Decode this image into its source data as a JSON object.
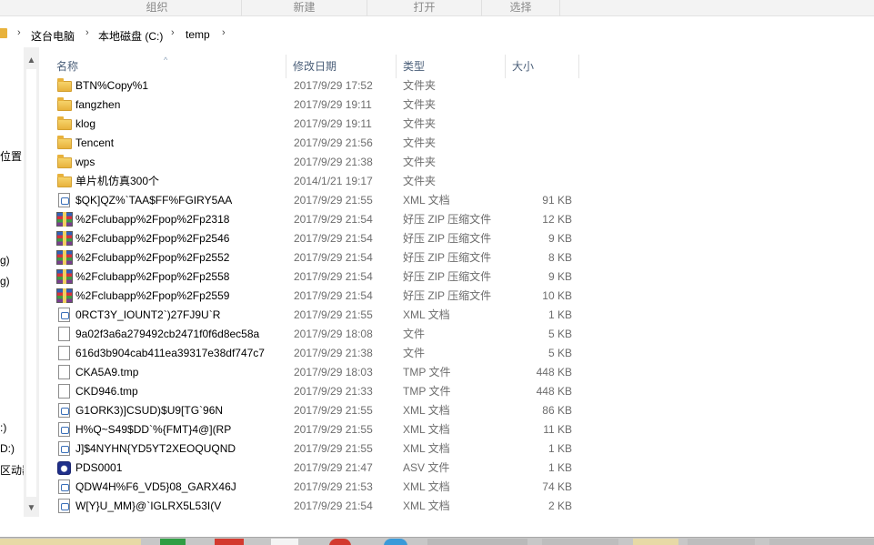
{
  "ribbon": {
    "groups": [
      "组织",
      "新建",
      "打开",
      "选择"
    ]
  },
  "address": {
    "crumbs": [
      "这台电脑",
      "本地磁盘 (C:)",
      "temp"
    ],
    "separator": "›"
  },
  "nav_pane": {
    "fragments": [
      "位置",
      "g)",
      "g)",
      ":)",
      "D:)",
      "区动器"
    ],
    "scroll_up": "▲",
    "scroll_down": "▼"
  },
  "columns": {
    "name": "名称",
    "date": "修改日期",
    "type": "类型",
    "size": "大小",
    "sort_indicator": "^"
  },
  "files": [
    {
      "name": "BTN%Copy%1",
      "date": "2017/9/29 17:52",
      "type": "文件夹",
      "size": "",
      "icon": "folder"
    },
    {
      "name": "fangzhen",
      "date": "2017/9/29 19:11",
      "type": "文件夹",
      "size": "",
      "icon": "folder"
    },
    {
      "name": "klog",
      "date": "2017/9/29 19:11",
      "type": "文件夹",
      "size": "",
      "icon": "folder"
    },
    {
      "name": "Tencent",
      "date": "2017/9/29 21:56",
      "type": "文件夹",
      "size": "",
      "icon": "folder"
    },
    {
      "name": "wps",
      "date": "2017/9/29 21:38",
      "type": "文件夹",
      "size": "",
      "icon": "folder"
    },
    {
      "name": "单片机仿真300个",
      "date": "2014/1/21 19:17",
      "type": "文件夹",
      "size": "",
      "icon": "folder"
    },
    {
      "name": "$QK]QZ%`TAA$FF%FGIRY5AA",
      "date": "2017/9/29 21:55",
      "type": "XML 文档",
      "size": "91 KB",
      "icon": "xml"
    },
    {
      "name": "%2Fclubapp%2Fpop%2Fp2318",
      "date": "2017/9/29 21:54",
      "type": "好压 ZIP 压缩文件",
      "size": "12 KB",
      "icon": "zip"
    },
    {
      "name": "%2Fclubapp%2Fpop%2Fp2546",
      "date": "2017/9/29 21:54",
      "type": "好压 ZIP 压缩文件",
      "size": "9 KB",
      "icon": "zip"
    },
    {
      "name": "%2Fclubapp%2Fpop%2Fp2552",
      "date": "2017/9/29 21:54",
      "type": "好压 ZIP 压缩文件",
      "size": "8 KB",
      "icon": "zip"
    },
    {
      "name": "%2Fclubapp%2Fpop%2Fp2558",
      "date": "2017/9/29 21:54",
      "type": "好压 ZIP 压缩文件",
      "size": "9 KB",
      "icon": "zip"
    },
    {
      "name": "%2Fclubapp%2Fpop%2Fp2559",
      "date": "2017/9/29 21:54",
      "type": "好压 ZIP 压缩文件",
      "size": "10 KB",
      "icon": "zip"
    },
    {
      "name": "0RCT3Y_IOUNT2`)27FJ9U`R",
      "date": "2017/9/29 21:55",
      "type": "XML 文档",
      "size": "1 KB",
      "icon": "xml"
    },
    {
      "name": "9a02f3a6a279492cb2471f0f6d8ec58a",
      "date": "2017/9/29 18:08",
      "type": "文件",
      "size": "5 KB",
      "icon": "file"
    },
    {
      "name": "616d3b904cab411ea39317e38df747c7",
      "date": "2017/9/29 21:38",
      "type": "文件",
      "size": "5 KB",
      "icon": "file"
    },
    {
      "name": "CKA5A9.tmp",
      "date": "2017/9/29 18:03",
      "type": "TMP 文件",
      "size": "448 KB",
      "icon": "file"
    },
    {
      "name": "CKD946.tmp",
      "date": "2017/9/29 21:33",
      "type": "TMP 文件",
      "size": "448 KB",
      "icon": "file"
    },
    {
      "name": "G1ORK3)]CSUD)$U9[TG`96N",
      "date": "2017/9/29 21:55",
      "type": "XML 文档",
      "size": "86 KB",
      "icon": "xml"
    },
    {
      "name": "H%Q~S49$DD`%{FMT}4@](RP",
      "date": "2017/9/29 21:55",
      "type": "XML 文档",
      "size": "11 KB",
      "icon": "xml"
    },
    {
      "name": "J]$4NYHN{YD5YT2XEOQUQND",
      "date": "2017/9/29 21:55",
      "type": "XML 文档",
      "size": "1 KB",
      "icon": "xml"
    },
    {
      "name": "PDS0001",
      "date": "2017/9/29 21:47",
      "type": "ASV 文件",
      "size": "1 KB",
      "icon": "asv"
    },
    {
      "name": "QDW4H%F6_VD5}08_GARX46J",
      "date": "2017/9/29 21:53",
      "type": "XML 文档",
      "size": "74 KB",
      "icon": "xml"
    },
    {
      "name": "W[Y}U_MM}@`IGLRX5L53I(V",
      "date": "2017/9/29 21:54",
      "type": "XML 文档",
      "size": "2 KB",
      "icon": "xml"
    }
  ],
  "colors": {
    "header_text": "#4c607a",
    "secondary_text": "#6d6d6d",
    "folder": "#e8b23c"
  }
}
